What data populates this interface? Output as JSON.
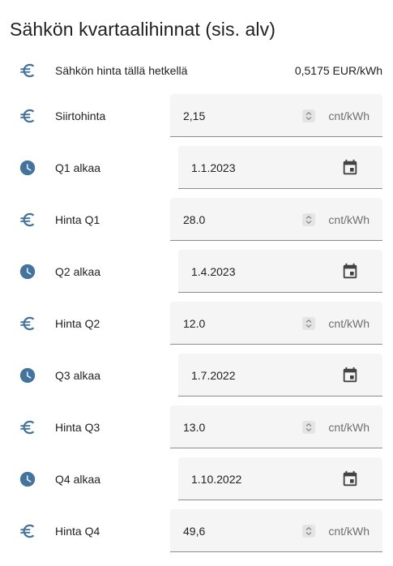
{
  "card": {
    "title": "Sähkön kvartaalihinnat (sis. alv)"
  },
  "colors": {
    "icon": "#44739e",
    "field_bg": "#f5f5f5",
    "underline": "#8c8c8c",
    "text": "#212121",
    "secondary_text": "#6f6f6f"
  },
  "rows": [
    {
      "kind": "state",
      "icon": "euro-icon",
      "label": "Sähkön hinta tällä hetkellä",
      "state": "0,5175 EUR/kWh"
    },
    {
      "kind": "number",
      "icon": "euro-icon",
      "label": "Siirtohinta",
      "value": "2,15",
      "unit": "cnt/kWh"
    },
    {
      "kind": "date",
      "icon": "clock-icon",
      "label": "Q1 alkaa",
      "value": "1.1.2023"
    },
    {
      "kind": "number",
      "icon": "euro-icon",
      "label": "Hinta Q1",
      "value": "28.0",
      "unit": "cnt/kWh"
    },
    {
      "kind": "date",
      "icon": "clock-icon",
      "label": "Q2 alkaa",
      "value": "1.4.2023"
    },
    {
      "kind": "number",
      "icon": "euro-icon",
      "label": "Hinta Q2",
      "value": "12.0",
      "unit": "cnt/kWh"
    },
    {
      "kind": "date",
      "icon": "clock-icon",
      "label": "Q3 alkaa",
      "value": "1.7.2022"
    },
    {
      "kind": "number",
      "icon": "euro-icon",
      "label": "Hinta Q3",
      "value": "13.0",
      "unit": "cnt/kWh"
    },
    {
      "kind": "date",
      "icon": "clock-icon",
      "label": "Q4 alkaa",
      "value": "1.10.2022"
    },
    {
      "kind": "number",
      "icon": "euro-icon",
      "label": "Hinta Q4",
      "value": "49,6",
      "unit": "cnt/kWh"
    }
  ]
}
